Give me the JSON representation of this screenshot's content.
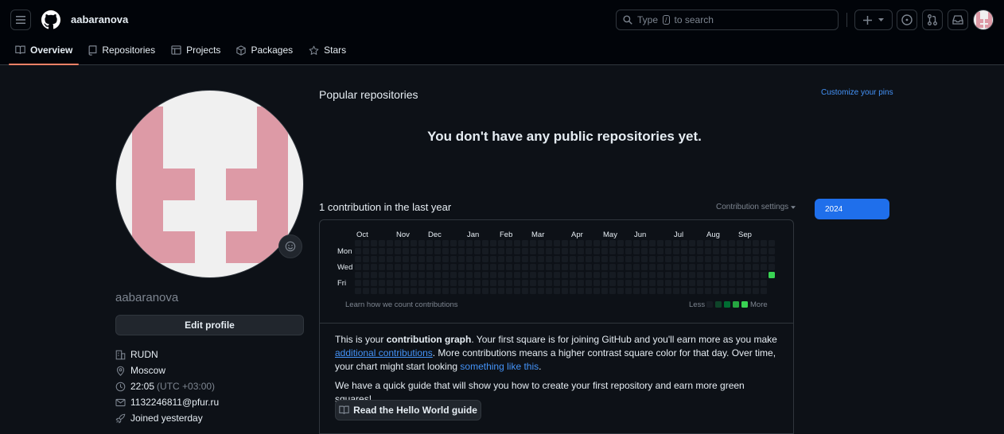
{
  "header": {
    "username": "aabaranova",
    "search_prefix": "Type",
    "search_key": "/",
    "search_suffix": "to search"
  },
  "tabs": [
    {
      "label": "Overview",
      "icon": "book-icon",
      "active": true
    },
    {
      "label": "Repositories",
      "icon": "repo-icon",
      "active": false
    },
    {
      "label": "Projects",
      "icon": "table-icon",
      "active": false
    },
    {
      "label": "Packages",
      "icon": "package-icon",
      "active": false
    },
    {
      "label": "Stars",
      "icon": "star-icon",
      "active": false
    }
  ],
  "profile": {
    "name": "aabaranova",
    "edit_label": "Edit profile",
    "org": "RUDN",
    "location": "Moscow",
    "time": "22:05",
    "timezone": "(UTC +03:00)",
    "email": "1132246811@pfur.ru",
    "joined": "Joined yesterday",
    "avatar_color": "#dd9aa6"
  },
  "popular": {
    "title": "Popular repositories",
    "customize": "Customize your pins",
    "empty": "You don't have any public repositories yet."
  },
  "contributions": {
    "title": "1 contribution in the last year",
    "settings": "Contribution settings",
    "year": "2024",
    "months": [
      "Oct",
      "Nov",
      "Dec",
      "Jan",
      "Feb",
      "Mar",
      "Apr",
      "May",
      "Jun",
      "Jul",
      "Aug",
      "Sep"
    ],
    "days": [
      "Mon",
      "Wed",
      "Fri"
    ],
    "learn": "Learn how we count contributions",
    "less": "Less",
    "more": "More",
    "total": 1,
    "colors": {
      "empty": "#161b22",
      "l1": "#0e4429",
      "l2": "#006d32",
      "l3": "#26a641",
      "l4": "#39d353"
    }
  },
  "info": {
    "p1_a": "This is your ",
    "p1_b": "contribution graph",
    "p1_c": ". Your first square is for joining GitHub and you'll earn more as you make ",
    "p1_link1": "additional contributions",
    "p1_d": ". More contributions means a higher contrast square color for that day. Over time, your chart might start looking ",
    "p1_link2": "something like this",
    "p1_e": ".",
    "p2": "We have a quick guide that will show you how to create your first repository and earn more green squares!",
    "guide_label": "Read the Hello World guide"
  }
}
